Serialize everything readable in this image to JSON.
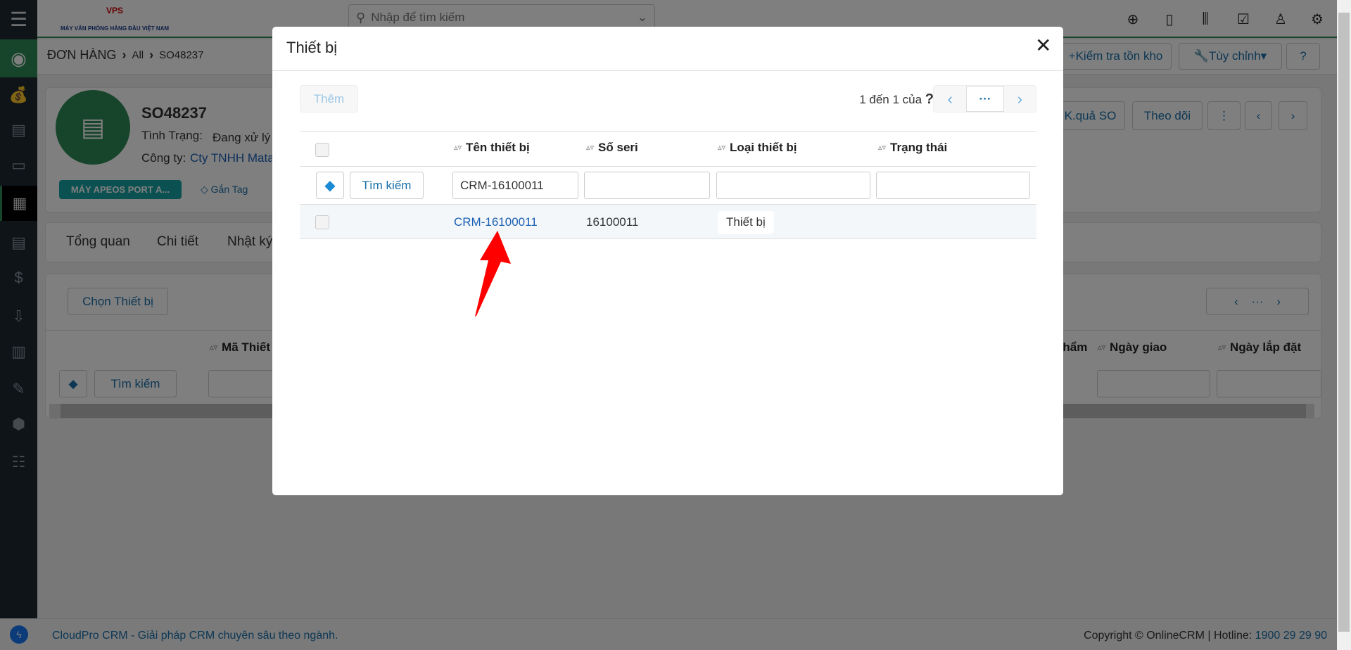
{
  "topbar": {
    "logo_text": "MÁY VĂN PHÒNG HÀNG ĐẦU VIỆT NAM",
    "logo_brand": "VPS",
    "search_placeholder": "Nhập để tìm kiếm",
    "icons": [
      "plus-circle-icon",
      "calendar-icon",
      "chart-icon",
      "checkbox-icon",
      "user-icon",
      "gear-icon"
    ]
  },
  "breadcrumb": {
    "module": "ĐƠN HÀNG",
    "filter": "All",
    "record": "SO48237"
  },
  "actions": {
    "check_stock": "Kiểm tra tồn kho",
    "customize": "Tùy chỉnh",
    "help": "?"
  },
  "record": {
    "title": "SO48237",
    "status_label": "Tình Trạng:",
    "status_value": "Đang xử lý",
    "company_label": "Công ty:",
    "company_value": "Cty TNHH Mata",
    "tag": "MÁY APEOS PORT A...",
    "add_tag": "Gắn Tag",
    "kqua_so": "K.quả SO",
    "follow": "Theo dõi"
  },
  "tabs": [
    "Tổng quan",
    "Chi tiết",
    "Nhật ký"
  ],
  "section": {
    "choose_button": "Chọn Thiết bị",
    "search_button": "Tìm kiếm",
    "columns": [
      "Mã Thiết",
      "nhẩm",
      "Ngày giao",
      "Ngày lắp đặt"
    ]
  },
  "footer": {
    "tagline": "CloudPro CRM - Giải pháp CRM chuyên sâu theo ngành.",
    "copyright": "Copyright © OnlineCRM",
    "hotline_label": "Hotline:",
    "hotline": "1900 29 29 90"
  },
  "modal": {
    "title": "Thiết bị",
    "add_button": "Thêm",
    "paging_text": "1 đến 1 của",
    "paging_help": "?",
    "search_button": "Tìm kiếm",
    "columns": [
      "Tên thiết bị",
      "Số seri",
      "Loại thiết bị",
      "Trạng thái"
    ],
    "filters": [
      "CRM-16100011",
      "",
      "",
      ""
    ],
    "rows": [
      {
        "name": "CRM-16100011",
        "serial": "16100011",
        "type": "Thiết bị",
        "status": ""
      }
    ]
  },
  "colors": {
    "accent": "#1a6fa8",
    "link": "#1a5fb4",
    "brand_green": "#2e8b57",
    "tag_teal": "#17a2a2",
    "arrow": "#ff0000"
  }
}
